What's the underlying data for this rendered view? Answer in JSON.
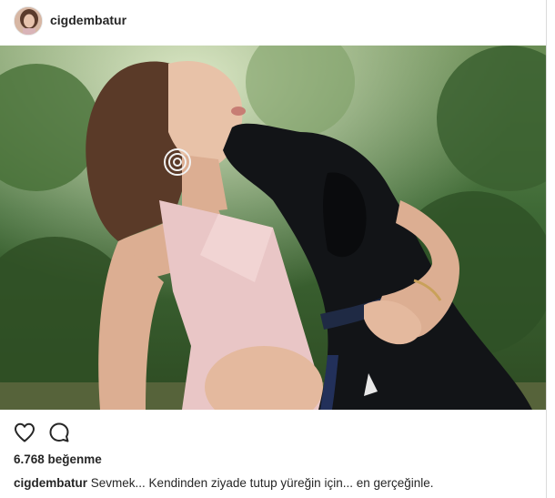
{
  "post": {
    "username": "cigdembatur",
    "likes_text": "6.768 beğenme",
    "caption_user": "cigdembatur",
    "caption_text": "Sevmek... Kendinden ziyade tutup yüreğin için... en gerçeğinle."
  },
  "icons": {
    "like": "heart-icon",
    "comment": "comment-icon"
  }
}
